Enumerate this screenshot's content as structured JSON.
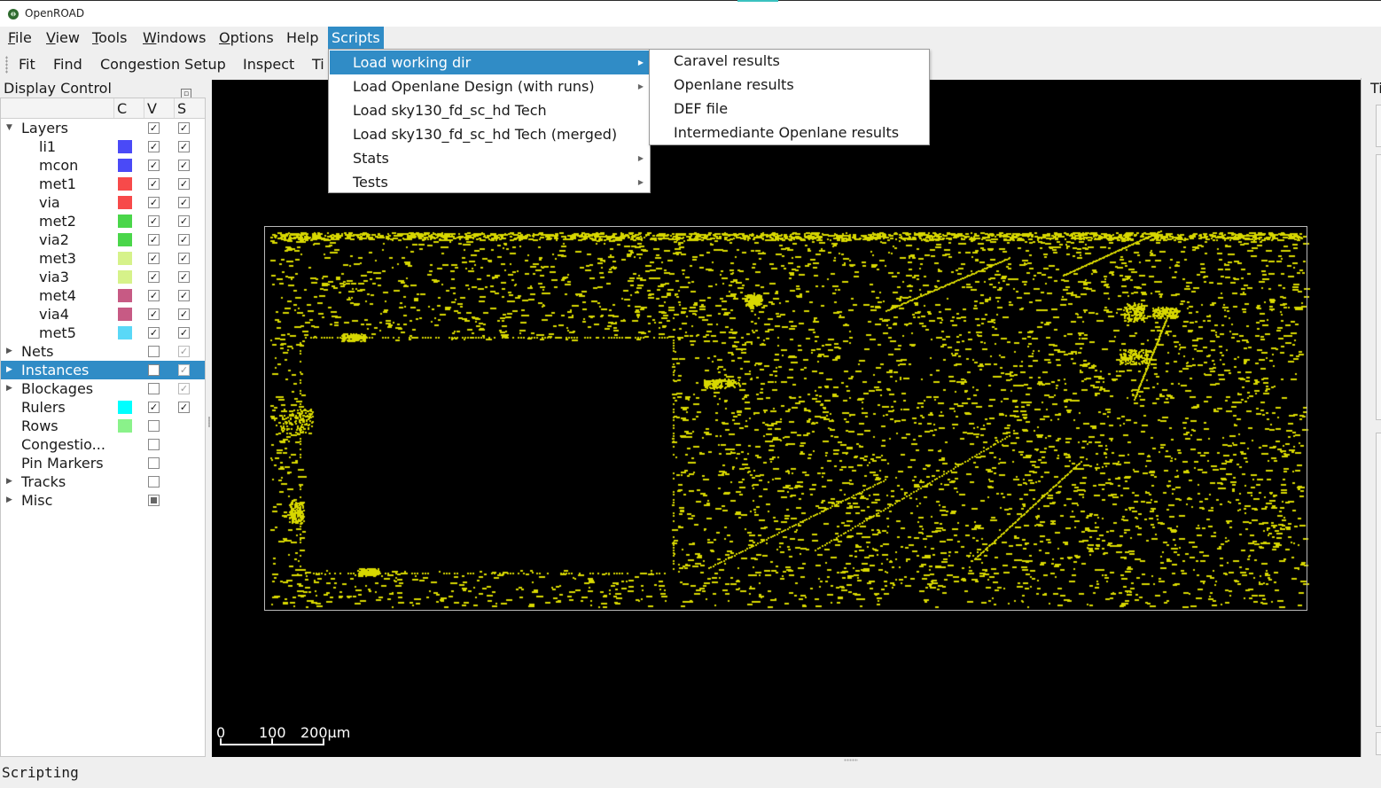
{
  "window": {
    "title": "OpenROAD"
  },
  "menubar": {
    "items": [
      {
        "label": "File",
        "ul": "F",
        "rest": "ile"
      },
      {
        "label": "View",
        "ul": "V",
        "rest": "iew"
      },
      {
        "label": "Tools",
        "ul": "T",
        "rest": "ools"
      },
      {
        "label": "Windows",
        "ul": "W",
        "rest": "indows"
      },
      {
        "label": "Options",
        "ul": "O",
        "rest": "ptions"
      },
      {
        "label": "Help",
        "ul": "",
        "rest": "Help"
      },
      {
        "label": "Scripts",
        "ul": "",
        "rest": "Scripts"
      }
    ]
  },
  "toolbar": {
    "fit": "Fit",
    "find": "Find",
    "congestion": "Congestion Setup",
    "inspect": "Inspect",
    "timing": "Ti"
  },
  "display_control": {
    "title": "Display Control",
    "columns": {
      "c": "C",
      "v": "V",
      "s": "S"
    },
    "rows": [
      {
        "label": "Layers",
        "expanded": true
      },
      {
        "label": "li1",
        "color": "#4a4af7"
      },
      {
        "label": "mcon",
        "color": "#4a4af7"
      },
      {
        "label": "met1",
        "color": "#f74a4a"
      },
      {
        "label": "via",
        "color": "#f74a4a"
      },
      {
        "label": "met2",
        "color": "#4ad64a"
      },
      {
        "label": "via2",
        "color": "#4ad64a"
      },
      {
        "label": "met3",
        "color": "#d6f28a"
      },
      {
        "label": "via3",
        "color": "#d6f28a"
      },
      {
        "label": "met4",
        "color": "#c75a84"
      },
      {
        "label": "via4",
        "color": "#c75a84"
      },
      {
        "label": "met5",
        "color": "#5ad8f7"
      },
      {
        "label": "Nets"
      },
      {
        "label": "Instances",
        "selected": true
      },
      {
        "label": "Blockages"
      },
      {
        "label": "Rulers",
        "color": "#00ffff"
      },
      {
        "label": "Rows",
        "color": "#8af28a"
      },
      {
        "label": "Congestio..."
      },
      {
        "label": "Pin Markers"
      },
      {
        "label": "Tracks"
      },
      {
        "label": "Misc"
      }
    ]
  },
  "viewer": {
    "scale": {
      "l0": "0",
      "l1": "100",
      "l2": "200µm"
    },
    "instance_color": "#d8d800"
  },
  "right_dock": {
    "title": "Ti"
  },
  "scripts_menu": {
    "items": [
      {
        "label": "Load working dir",
        "submenu": true,
        "highlighted": true
      },
      {
        "label": "Load Openlane Design (with runs)",
        "submenu": true
      },
      {
        "label": "Load sky130_fd_sc_hd Tech"
      },
      {
        "label": "Load sky130_fd_sc_hd Tech (merged)"
      },
      {
        "label": "Stats",
        "submenu": true
      },
      {
        "label": "Tests",
        "submenu": true
      }
    ]
  },
  "working_dir_submenu": {
    "items": [
      {
        "label": "Caravel results"
      },
      {
        "label": "Openlane results"
      },
      {
        "label": "DEF file"
      },
      {
        "label": "Intermediante Openlane results"
      }
    ]
  },
  "status": {
    "text": "Scripting"
  }
}
